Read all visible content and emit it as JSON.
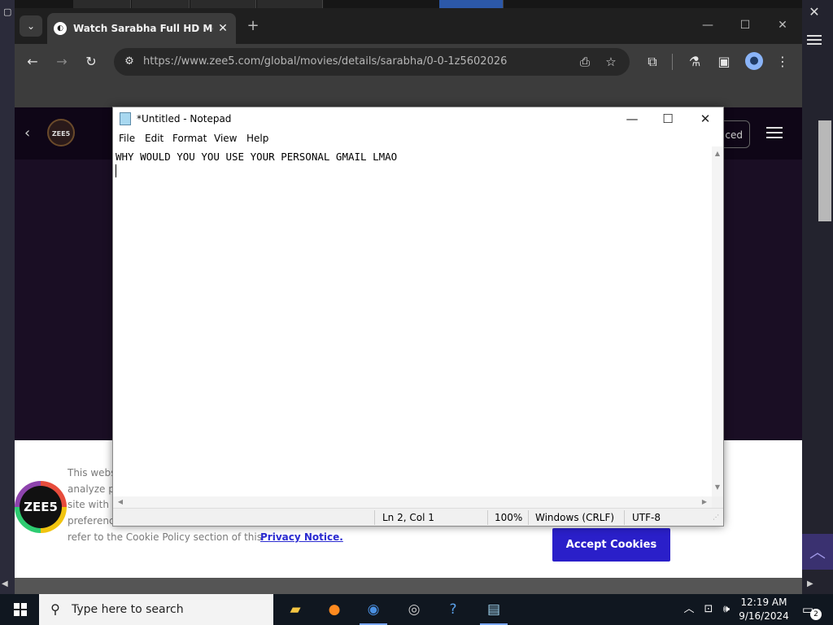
{
  "browser": {
    "tab_title": "Watch Sarabha Full HD Movie",
    "url": "https://www.zee5.com/global/movies/details/sarabha/0-0-1z5602026"
  },
  "site": {
    "logo_text": "ZEE5",
    "header_button_partial": "ced",
    "cookie_lines": [
      "This webs",
      "analyze p",
      "site with c",
      "preferenc",
      "refer to the Cookie Policy section of this"
    ],
    "privacy_link": "Privacy Notice.",
    "accept_button": "Accept Cookies"
  },
  "notepad": {
    "title": "*Untitled - Notepad",
    "menu": [
      "File",
      "Edit",
      "Format",
      "View",
      "Help"
    ],
    "content": "WHY WOULD YOU YOU USE YOUR PERSONAL GMAIL LMAO",
    "status": {
      "position": "Ln 2, Col 1",
      "zoom": "100%",
      "line_ending": "Windows (CRLF)",
      "encoding": "UTF-8"
    }
  },
  "taskbar": {
    "search_placeholder": "Type here to search",
    "time": "12:19 AM",
    "date": "9/16/2024",
    "notification_count": "2"
  },
  "colors": {
    "accept_button": "#2a1fc9",
    "privacy_link": "#2b2bd1",
    "chrome_toolbar": "#3c3c3c",
    "site_background": "#1a0e24"
  }
}
